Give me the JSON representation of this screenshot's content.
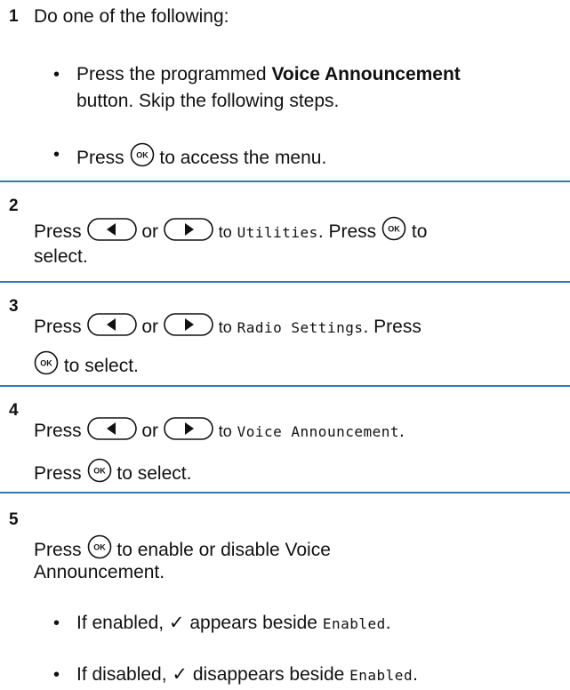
{
  "steps": [
    {
      "number": "1",
      "intro": "Do one of the following:",
      "option1_pre": "Press the programmed ",
      "option1_bold": "Voice Announcement",
      "option1_line2": "button. Skip the following steps.",
      "option2_pre": "Press",
      "option2_post": "to access the menu."
    },
    {
      "number": "2",
      "press": "Press",
      "or": "or",
      "to": "to",
      "menu_item": "Utilities",
      "after": ". Press",
      "to_end": "to",
      "line2": "select."
    },
    {
      "number": "3",
      "press": "Press",
      "or": "or",
      "to": "to",
      "menu_item": "Radio Settings",
      "after": ". Press",
      "line2_post": "to select."
    },
    {
      "number": "4",
      "press": "Press",
      "or": "or",
      "to": "to",
      "menu_item": "Voice Announcement",
      "after": ".",
      "line2_pre": "Press",
      "line2_post": "to select."
    },
    {
      "number": "5",
      "line1_pre": "Press",
      "line1_post": "to enable or disable Voice",
      "line2": "Announcement.",
      "result1_pre": "If enabled, ",
      "result1_mid": " appears beside ",
      "result1_item": "Enabled",
      "result1_end": ".",
      "result2_pre": "If disabled, ",
      "result2_mid": " disappears beside ",
      "result2_item": "Enabled",
      "result2_end": "."
    }
  ],
  "glyphs": {
    "bullet": "•",
    "check": "✓",
    "ok_label": "OK"
  },
  "colors": {
    "divider": "#2f7ab3",
    "text": "#111111"
  }
}
